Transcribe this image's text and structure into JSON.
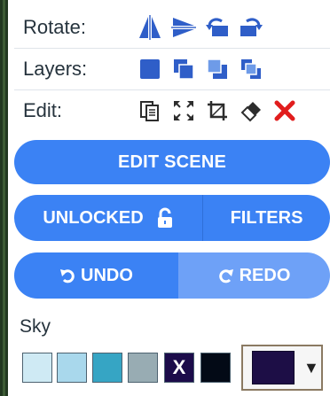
{
  "toolbar": {
    "rotate_label": "Rotate:",
    "layers_label": "Layers:",
    "edit_label": "Edit:",
    "rotate_icons": [
      "flip-horizontal-icon",
      "flip-vertical-icon",
      "rotate-left-icon",
      "rotate-right-icon"
    ],
    "layers_icons": [
      "bring-to-front-icon",
      "bring-forward-icon",
      "send-backward-icon",
      "send-to-back-icon"
    ],
    "edit_icons": [
      "copy-icon",
      "fit-icon",
      "crop-icon",
      "eraser-icon",
      "delete-icon"
    ]
  },
  "buttons": {
    "edit_scene": "EDIT SCENE",
    "unlocked": "UNLOCKED",
    "filters": "FILTERS",
    "undo": "UNDO",
    "redo": "REDO"
  },
  "sky": {
    "label": "Sky",
    "swatches": [
      "#cfeaf4",
      "#a9d8ec",
      "#36a5c4",
      "#98acb3",
      "#1c0c4a",
      "#030a16"
    ],
    "selected_swatch_mark": "X",
    "picker_color": "#1d0e46",
    "picker_arrow": "▼"
  },
  "colors": {
    "accent": "#3b82f4",
    "accent_disabled": "#6ea1f7",
    "icon_blue": "#2f5ec8",
    "delete_red": "#e11d1d"
  }
}
